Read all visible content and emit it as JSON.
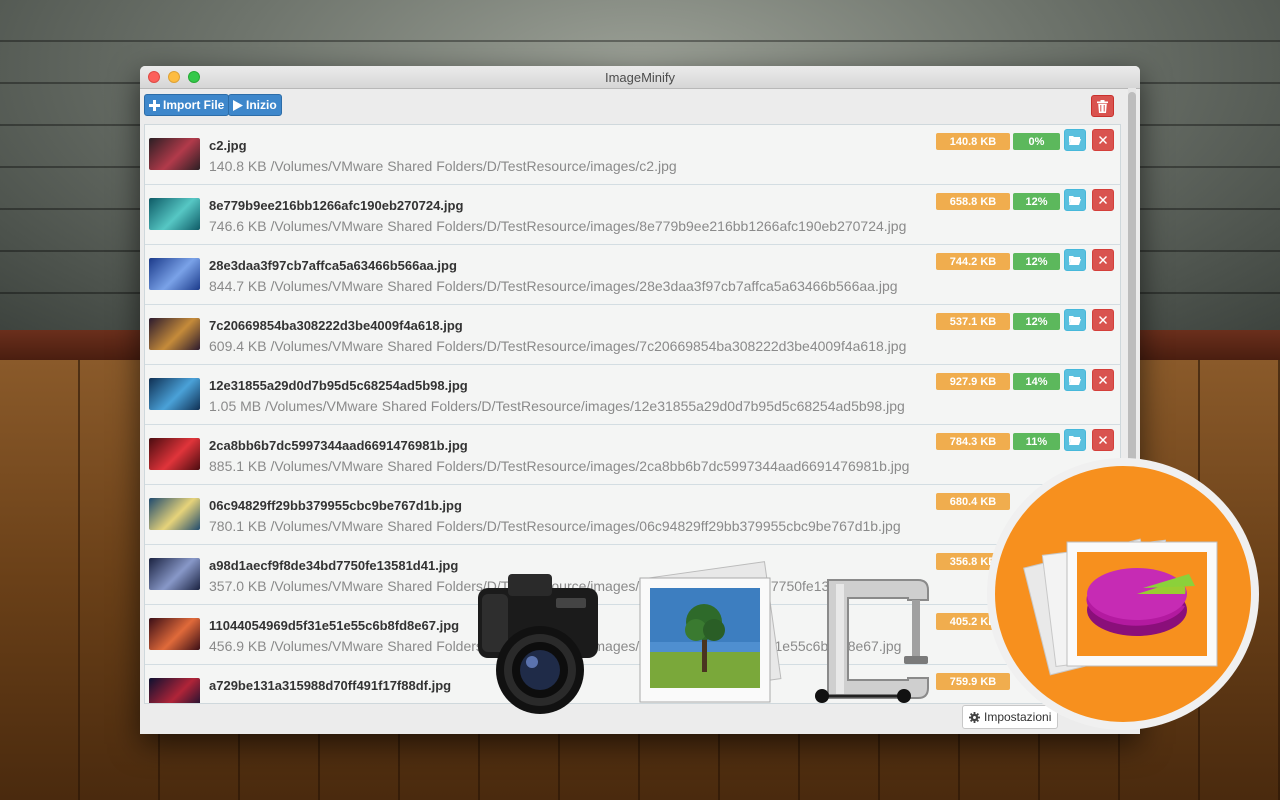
{
  "window": {
    "title": "ImageMinify"
  },
  "toolbar": {
    "import_label": "Import File",
    "start_label": "Inizio"
  },
  "files": [
    {
      "name": "c2.jpg",
      "detail": "140.8 KB /Volumes/VMware Shared Folders/D/TestResource/images/c2.jpg",
      "size": "140.8 KB",
      "saved": "0%",
      "thumb_colors": [
        "#2a1f24",
        "#b23a4a"
      ]
    },
    {
      "name": "8e779b9ee216bb1266afc190eb270724.jpg",
      "detail": "746.6 KB /Volumes/VMware Shared Folders/D/TestResource/images/8e779b9ee216bb1266afc190eb270724.jpg",
      "size": "658.8 KB",
      "saved": "12%",
      "thumb_colors": [
        "#0e5a66",
        "#56c7c4"
      ]
    },
    {
      "name": "28e3daa3f97cb7affca5a63466b566aa.jpg",
      "detail": "844.7 KB /Volumes/VMware Shared Folders/D/TestResource/images/28e3daa3f97cb7affca5a63466b566aa.jpg",
      "size": "744.2 KB",
      "saved": "12%",
      "thumb_colors": [
        "#1b3a8a",
        "#7aa2e8"
      ]
    },
    {
      "name": "7c20669854ba308222d3be4009f4a618.jpg",
      "detail": "609.4 KB /Volumes/VMware Shared Folders/D/TestResource/images/7c20669854ba308222d3be4009f4a618.jpg",
      "size": "537.1 KB",
      "saved": "12%",
      "thumb_colors": [
        "#2b1a2e",
        "#c58b3a"
      ]
    },
    {
      "name": "12e31855a29d0d7b95d5c68254ad5b98.jpg",
      "detail": "1.05 MB /Volumes/VMware Shared Folders/D/TestResource/images/12e31855a29d0d7b95d5c68254ad5b98.jpg",
      "size": "927.9 KB",
      "saved": "14%",
      "thumb_colors": [
        "#0f2f52",
        "#4aa1d8"
      ]
    },
    {
      "name": "2ca8bb6b7dc5997344aad6691476981b.jpg",
      "detail": "885.1 KB /Volumes/VMware Shared Folders/D/TestResource/images/2ca8bb6b7dc5997344aad6691476981b.jpg",
      "size": "784.3 KB",
      "saved": "11%",
      "thumb_colors": [
        "#4a0c10",
        "#e0343a"
      ]
    },
    {
      "name": "06c94829ff29bb379955cbc9be767d1b.jpg",
      "detail": "780.1 KB /Volumes/VMware Shared Folders/D/TestResource/images/06c94829ff29bb379955cbc9be767d1b.jpg",
      "size": "680.4 KB",
      "saved": "",
      "thumb_colors": [
        "#1f4a6e",
        "#e6d37a"
      ]
    },
    {
      "name": "a98d1aecf9f8de34bd7750fe13581d41.jpg",
      "detail": "357.0 KB /Volumes/VMware Shared Folders/D/TestResource/images/a98d1aecf9f8de34bd7750fe13581d41.jpg",
      "size": "356.8 KB",
      "saved": "",
      "thumb_colors": [
        "#1a2240",
        "#8898c8"
      ]
    },
    {
      "name": "11044054969d5f31e51e55c6b8fd8e67.jpg",
      "detail": "456.9 KB /Volumes/VMware Shared Folders/D/TestResource/images/11044054969d5f31e51e55c6b8fd8e67.jpg",
      "size": "405.2 KB",
      "saved": "",
      "thumb_colors": [
        "#3a0e16",
        "#e06a3a"
      ]
    },
    {
      "name": "a729be131a315988d70ff491f17f88df.jpg",
      "detail": "",
      "size": "759.9 KB",
      "saved": "",
      "thumb_colors": [
        "#0c1030",
        "#b02438"
      ]
    }
  ],
  "footer": {
    "settings_label": "Impostazioni"
  },
  "icons": {
    "import": "plus-icon",
    "start": "play-icon",
    "clear": "trash-icon",
    "open": "folder-open-icon",
    "remove": "close-icon",
    "settings": "gear-icon"
  },
  "colors": {
    "primary": "#3e87cb",
    "danger": "#d9534f",
    "warning": "#f0ad4e",
    "success": "#5cb85c",
    "info": "#5bc0de",
    "logo_orange": "#f7901e"
  }
}
